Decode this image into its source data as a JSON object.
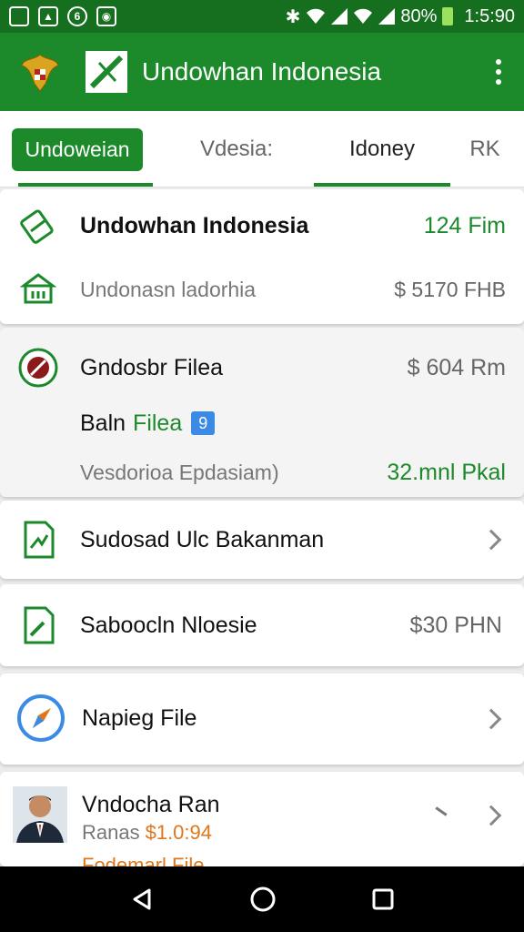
{
  "status_bar": {
    "battery": "80%",
    "time": "1:5:90"
  },
  "app_bar": {
    "title": "Undowhan Indonesia"
  },
  "tabs": [
    {
      "label": "Undoweian"
    },
    {
      "label": "Vdesia:"
    },
    {
      "label": "Idoney"
    },
    {
      "label": "RK"
    }
  ],
  "cards": {
    "summary": {
      "title": "Undowhan Indonesia",
      "amount": "124 Fim",
      "subtitle": "Undonasn ladorhia",
      "sub_amount": "$ 5170 FHB"
    },
    "file": {
      "title": "Gndosbr Filea",
      "amount": "$ 604 Rm",
      "tag_prefix": "Baln",
      "tag_link": "Filea",
      "badge": "9",
      "caption": "Vesdorioa Epdasiam)",
      "caption_amount": "32.mnl Pkal"
    },
    "item1": {
      "title": "Sudosad Ulc Bakanman"
    },
    "item2": {
      "title": "Saboocln Nloesie",
      "amount": "$30 PHN"
    },
    "item3": {
      "title": "Napieg File"
    },
    "profile": {
      "title": "Vndocha Ran",
      "sub_prefix": "Ranas",
      "sub_amount": "$1.0:94",
      "footer": "Fodemarl File"
    }
  },
  "colors": {
    "primary": "#1c8a2b",
    "status_bar": "#166e1f",
    "accent_orange": "#e0761a",
    "badge_blue": "#3a8ae6"
  }
}
